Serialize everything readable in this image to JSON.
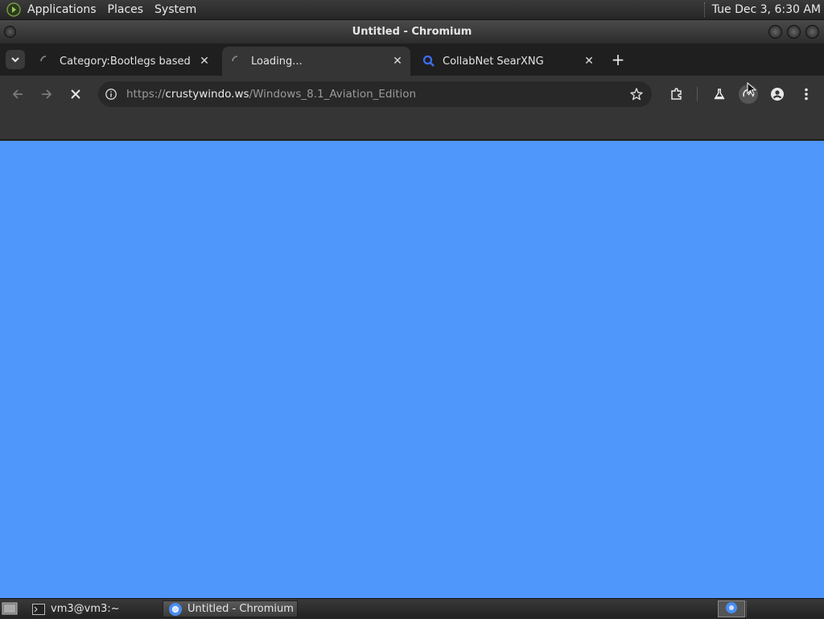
{
  "top_panel": {
    "menus": [
      "Applications",
      "Places",
      "System"
    ],
    "clock": "Tue Dec  3,  6:30 AM"
  },
  "window": {
    "title": "Untitled - Chromium"
  },
  "tabs": [
    {
      "label": "Category:Bootlegs based on",
      "icon": "loading-spinner-icon",
      "active": false
    },
    {
      "label": "Loading...",
      "icon": "loading-spinner-icon",
      "active": true
    },
    {
      "label": "CollabNet SearXNG",
      "icon": "search-icon",
      "active": false
    }
  ],
  "toolbar": {
    "url_scheme": "https://",
    "url_host": "crustywindo.ws",
    "url_path": "/Windows_8.1_Aviation_Edition"
  },
  "taskbar": {
    "items": [
      {
        "label": "vm3@vm3:~",
        "icon": "terminal-icon"
      },
      {
        "label": "Untitled - Chromium",
        "icon": "chromium-icon"
      }
    ]
  },
  "colors": {
    "page_background": "#5097fc",
    "chrome_dark": "#353535",
    "tabstrip": "#1f1f1f"
  }
}
